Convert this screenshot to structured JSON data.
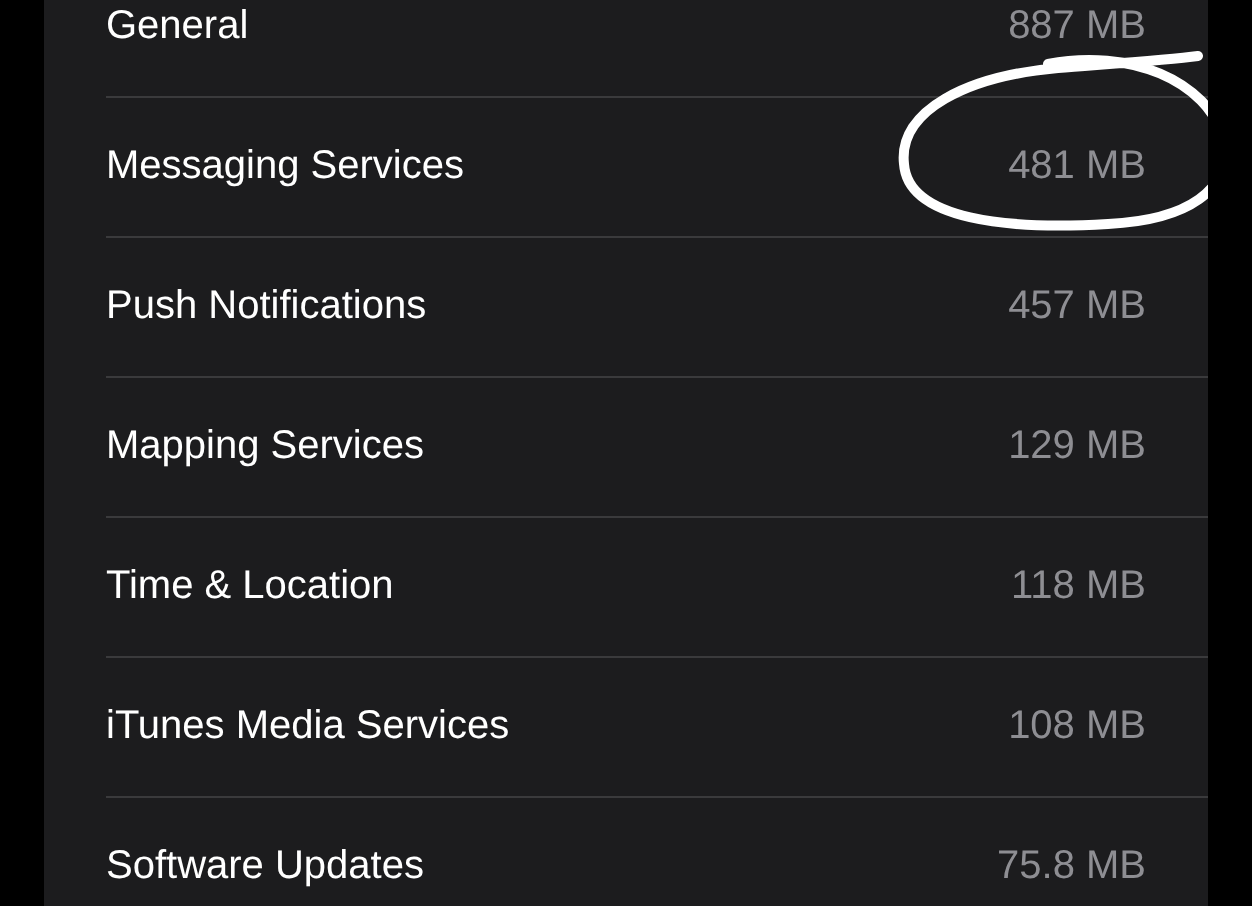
{
  "storage_items": [
    {
      "name": "General",
      "size": "887 MB",
      "circled": false
    },
    {
      "name": "Messaging Services",
      "size": "481 MB",
      "circled": true
    },
    {
      "name": "Push Notifications",
      "size": "457 MB",
      "circled": false
    },
    {
      "name": "Mapping Services",
      "size": "129 MB",
      "circled": false
    },
    {
      "name": "Time & Location",
      "size": "118 MB",
      "circled": false
    },
    {
      "name": "iTunes Media Services",
      "size": "108 MB",
      "circled": false
    },
    {
      "name": "Software Updates",
      "size": "75.8 MB",
      "circled": false
    }
  ]
}
